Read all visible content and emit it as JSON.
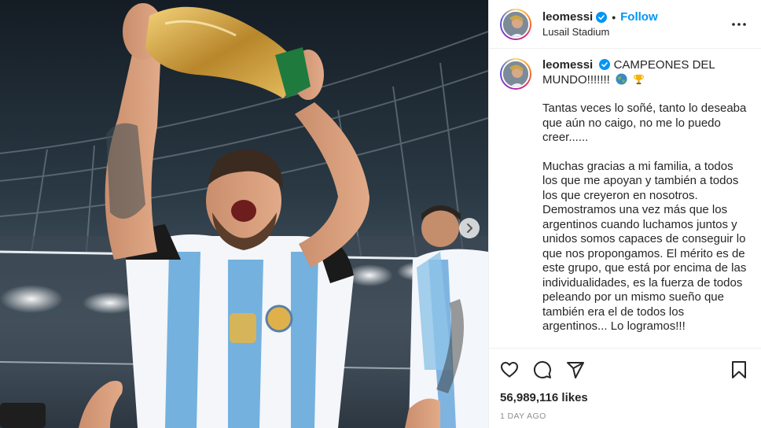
{
  "post": {
    "username": "leomessi",
    "verified": true,
    "follow_label": "Follow",
    "separator": "•",
    "location": "Lusail Stadium",
    "more_icon": "more-horizontal-icon",
    "caption": {
      "username": "leomessi",
      "first_line": "CAMPEONES DEL MUNDO!!!!!!!",
      "paragraphs": [
        "Tantas veces lo soñé, tanto lo deseaba que aún no caigo, no me lo puedo creer......",
        "Muchas gracias a mi familia, a todos los que me apoyan y también a todos los que creyeron en nosotros. Demostramos una vez más que los argentinos cuando luchamos juntos y unidos somos capaces de conseguir lo que nos propongamos. El mérito es de este grupo, que está por encima de las individualidades, es la fuerza de todos peleando por un mismo sueño que también era el de todos los argentinos... Lo logramos!!!"
      ]
    },
    "likes": "56,989,116 likes",
    "timestamp": "1 DAY AGO",
    "icons": [
      "heart-icon",
      "comment-icon",
      "share-icon",
      "bookmark-icon",
      "chevron-right-icon",
      "verified-badge-icon",
      "globe-emoji-icon",
      "trophy-emoji-icon"
    ],
    "colors": {
      "follow": "#0095f6",
      "verified": "#0095f6",
      "secondary_text": "#8e8e8e",
      "divider": "#efefef"
    }
  }
}
